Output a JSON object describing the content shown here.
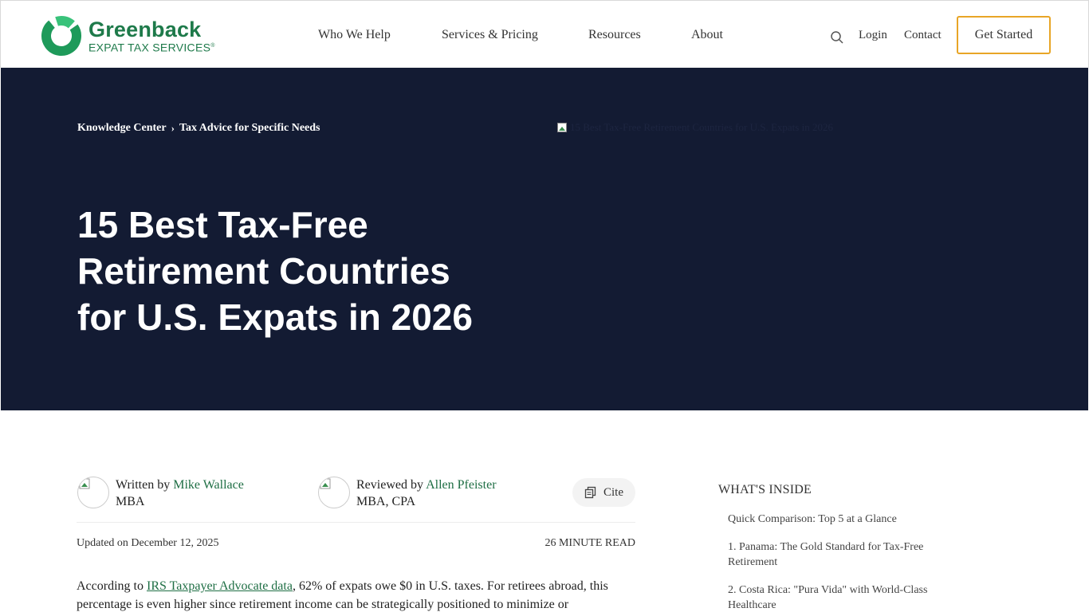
{
  "brand": {
    "name": "Greenback",
    "sub": "EXPAT TAX SERVICES",
    "registered": "®",
    "color": "#1e7a4a"
  },
  "nav": {
    "items": [
      "Who We Help",
      "Services & Pricing",
      "Resources",
      "About"
    ],
    "login": "Login",
    "contact": "Contact",
    "cta": "Get Started"
  },
  "hero": {
    "breadcrumb": [
      "Knowledge Center",
      "Tax Advice for Specific Needs"
    ],
    "image_alt": "15 Best Tax-Free Retirement Countries for U.S. Expats in 2026",
    "title": "15 Best Tax-Free Retirement Countries for U.S. Expats in 2026",
    "bg_color": "#131b33"
  },
  "authors": {
    "writer_prefix": "Written by",
    "writer_name": "Mike Wallace",
    "writer_cred": "MBA",
    "reviewer_prefix": "Reviewed by",
    "reviewer_name": "Allen Pfeister",
    "reviewer_cred": "MBA, CPA",
    "cite": "Cite"
  },
  "meta": {
    "updated": "Updated on December 12, 2025",
    "read_time": "26 MINUTE READ"
  },
  "intro": {
    "prefix": "According to ",
    "link": "IRS Taxpayer Advocate data",
    "rest": ", 62% of expats owe $0 in U.S. taxes. For retirees abroad, this percentage is even higher since retirement income can be strategically positioned to minimize or"
  },
  "toc": {
    "heading": "WHAT'S INSIDE",
    "items": [
      "Quick Comparison: Top 5 at a Glance",
      "1. Panama: The Gold Standard for Tax-Free Retirement",
      "2. Costa Rica: \"Pura Vida\" with World-Class Healthcare"
    ]
  },
  "icons": {
    "search": "search-icon",
    "cite": "copy-icon",
    "breadcrumb_sep": "chevron-right-icon"
  }
}
